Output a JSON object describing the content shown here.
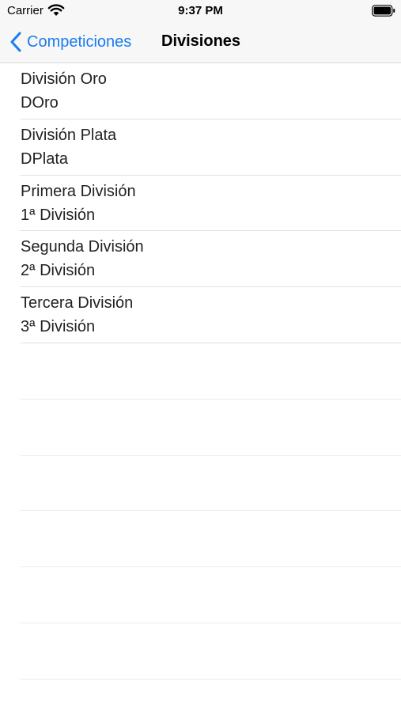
{
  "status_bar": {
    "carrier": "Carrier",
    "time": "9:37 PM",
    "wifi_icon": "wifi-icon",
    "battery_icon": "battery-icon"
  },
  "nav": {
    "back_label": "Competiciones",
    "back_icon": "chevron-left-icon",
    "title": "Divisiones",
    "accent_color": "#1a7cf0"
  },
  "divisions": [
    {
      "name": "División Oro",
      "short": "DOro"
    },
    {
      "name": "División Plata",
      "short": "DPlata"
    },
    {
      "name": "Primera División",
      "short": "1ª División"
    },
    {
      "name": "Segunda División",
      "short": "2ª División"
    },
    {
      "name": "Tercera División",
      "short": "3ª División"
    }
  ]
}
